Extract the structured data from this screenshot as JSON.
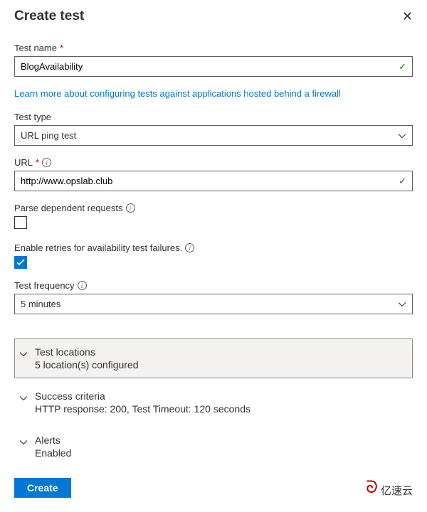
{
  "header": {
    "title": "Create test"
  },
  "testName": {
    "label": "Test name",
    "value": "BlogAvailability"
  },
  "learnMoreLink": "Learn more about configuring tests against applications hosted behind a firewall",
  "testType": {
    "label": "Test type",
    "value": "URL ping test"
  },
  "url": {
    "label": "URL",
    "value": "http://www.opslab.club"
  },
  "parseDependent": {
    "label": "Parse dependent requests",
    "checked": false
  },
  "enableRetries": {
    "label": "Enable retries for availability test failures.",
    "checked": true
  },
  "testFrequency": {
    "label": "Test frequency",
    "value": "5 minutes"
  },
  "sections": {
    "locations": {
      "title": "Test locations",
      "sub": "5 location(s) configured"
    },
    "success": {
      "title": "Success criteria",
      "sub": "HTTP response: 200, Test Timeout: 120 seconds"
    },
    "alerts": {
      "title": "Alerts",
      "sub": "Enabled"
    }
  },
  "createButton": "Create",
  "watermark": "亿速云"
}
